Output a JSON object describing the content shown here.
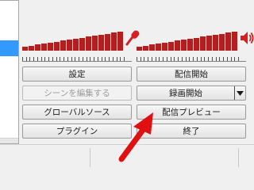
{
  "controls": {
    "settings": "設定",
    "start_stream": "配信開始",
    "edit_scene": "シーンを編集する",
    "start_recording": "録画開始",
    "global_sources": "グローバルソース",
    "stream_preview": "配信プレビュー",
    "plugins": "プラグイン",
    "exit": "終了"
  },
  "meters": {
    "microphone": {
      "icon": "microphone-icon",
      "level": 1.0,
      "bars": 16
    },
    "speaker": {
      "icon": "speaker-icon",
      "level": 1.0,
      "bars": 16
    }
  },
  "colors": {
    "meter_bar": "#b51e1e",
    "icon": "#d42020",
    "arrow": "#e01010",
    "selection": "#3399ff"
  }
}
